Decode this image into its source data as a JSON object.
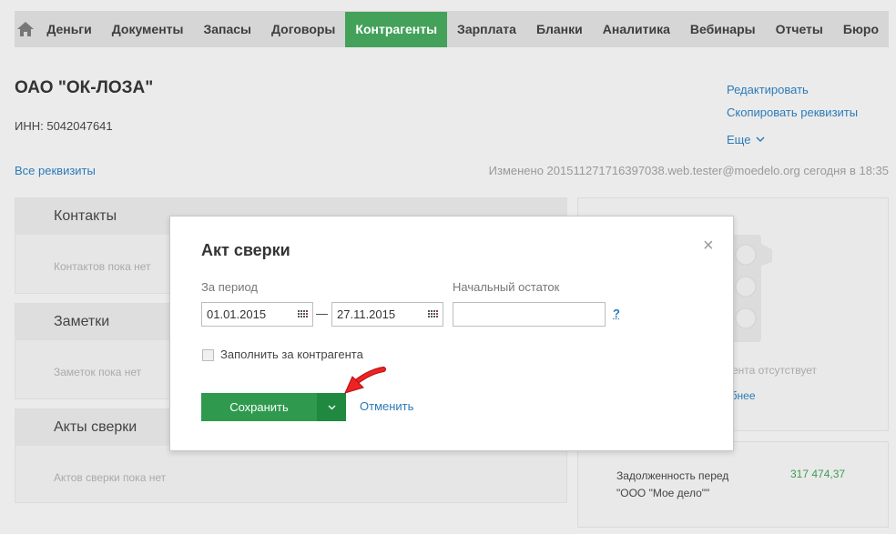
{
  "nav": {
    "items": [
      "Деньги",
      "Документы",
      "Запасы",
      "Договоры",
      "Контрагенты",
      "Зарплата",
      "Бланки",
      "Аналитика",
      "Вебинары",
      "Отчеты",
      "Бюро"
    ],
    "active": "Контрагенты",
    "home_icon": "home-icon"
  },
  "company": {
    "name": "ОАО \"ОК-ЛОЗА\"",
    "inn": "ИНН: 5042047641",
    "all_requisites": "Все реквизиты",
    "changed": "Изменено 201511271716397038.web.tester@moedelo.org сегодня в 18:35"
  },
  "actions": {
    "edit": "Редактировать",
    "copy": "Скопировать реквизиты",
    "more": "Еще"
  },
  "panels": [
    {
      "title": "Контакты",
      "empty": "Контактов пока нет"
    },
    {
      "title": "Заметки",
      "empty": "Заметок пока нет"
    },
    {
      "title": "Акты сверки",
      "empty": "Актов сверки пока нет"
    }
  ],
  "right": {
    "missing": "ента отсутствует",
    "more": "обнее",
    "debt_label_1": "Задолженность перед",
    "debt_label_2": "\"ООО \"Мое дело\"\"",
    "debt_value": "317 474,37"
  },
  "modal": {
    "title": "Акт сверки",
    "period_label": "За период",
    "date_from": "01.01.2015",
    "date_to": "27.11.2015",
    "dash": "—",
    "balance_label": "Начальный остаток",
    "balance_value": "",
    "help": "?",
    "fill_checkbox_label": "Заполнить за контрагента",
    "fill_checked": false,
    "save_label": "Сохранить",
    "cancel_label": "Отменить",
    "close": "×"
  },
  "colors": {
    "accent": "#43a15a",
    "link": "#2b7bb9",
    "annotation_arrow": "#e02020"
  }
}
